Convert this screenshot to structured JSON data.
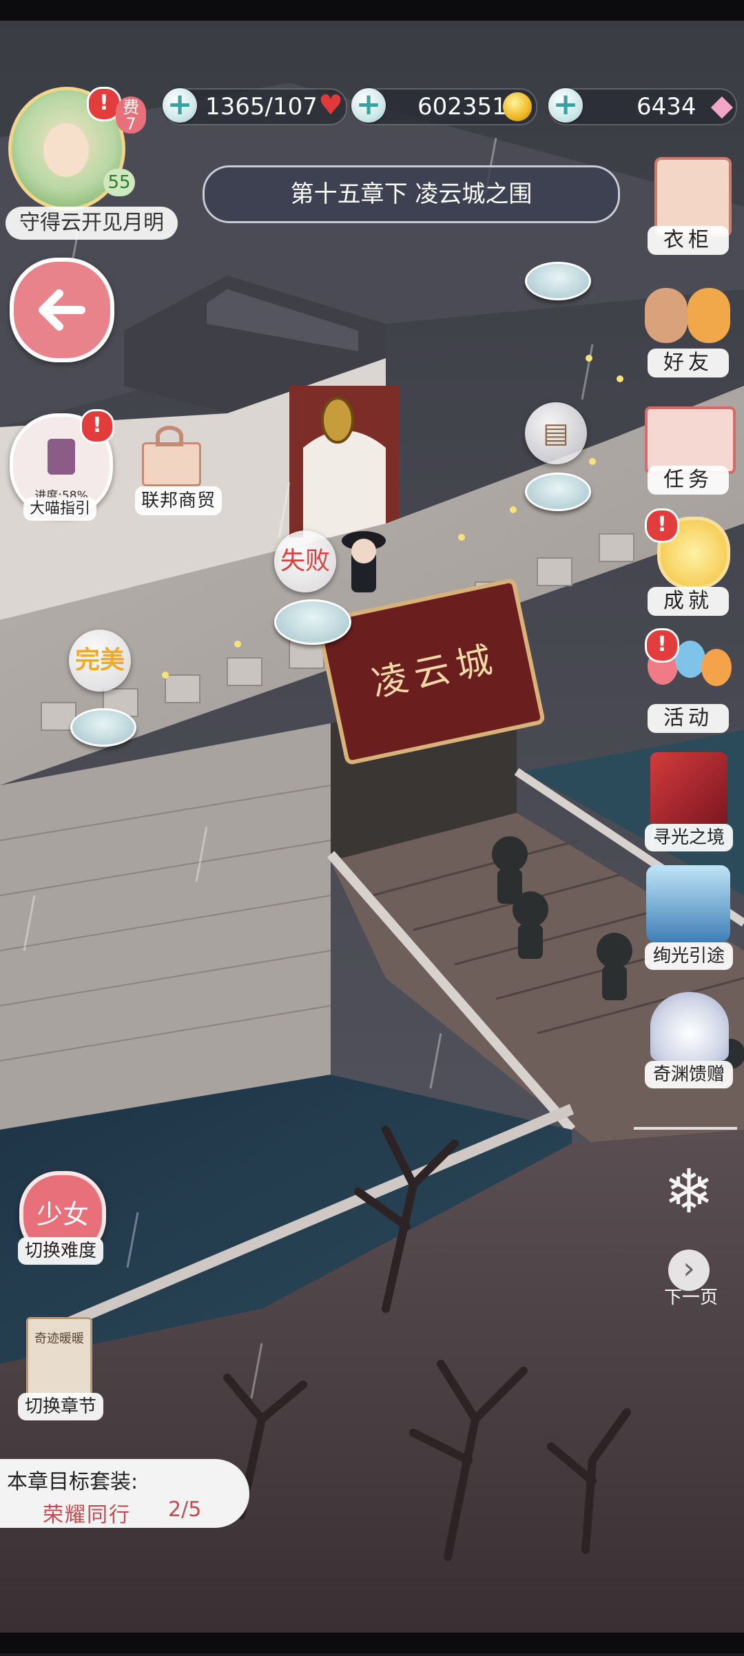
{
  "status": {
    "player_level": "7",
    "player_level_prefix": "费",
    "avatar_level": "55",
    "player_name": "守得云开见月明"
  },
  "currencies": {
    "stamina": "1365/107",
    "gold": "602351",
    "diamonds": "6434"
  },
  "chapter_title": "第十五章下 凌云城之围",
  "left_panel": {
    "guide_label": "大喵指引",
    "guide_progress": "进度:58%",
    "trade_label": "联邦商贸",
    "difficulty_badge": "少女",
    "difficulty_label": "切换难度",
    "chapter_switch_label": "切换章节",
    "chapter_book_title": "奇迹暖暖"
  },
  "right_menu": {
    "wardrobe": "衣柜",
    "friends": "好友",
    "tasks": "任务",
    "achievements": "成就",
    "events": "活动",
    "seek_light": "寻光之境",
    "radiant_path": "绚光引途",
    "abyss_gift": "奇渊馈赠",
    "next_page": "下一页"
  },
  "map": {
    "gate_sign": "凌云城",
    "node_result_fail": "失败",
    "node_result_perfect": "完美"
  },
  "goal": {
    "title": "本章目标套装:",
    "suit_name": "荣耀同行",
    "progress": "2/5"
  },
  "colors": {
    "accent_pink": "#e8707a",
    "fail_red": "#d8403c",
    "perfect_gold": "#f2a92a"
  }
}
